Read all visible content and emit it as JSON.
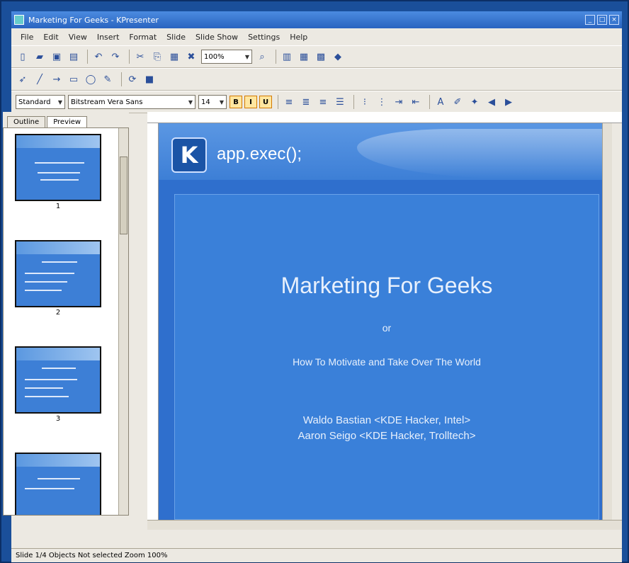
{
  "window": {
    "title": "Marketing For Geeks - KPresenter"
  },
  "menu": [
    "File",
    "Edit",
    "View",
    "Insert",
    "Format",
    "Slide",
    "Slide Show",
    "Settings",
    "Help"
  ],
  "toolbar1": {
    "zoom": "100%"
  },
  "format_toolbar": {
    "style": "Standard",
    "font": "Bitstream Vera Sans",
    "size": "14"
  },
  "sidebar": {
    "tabs": [
      "Outline",
      "Preview"
    ],
    "slides": [
      "1",
      "2",
      "3"
    ]
  },
  "slide": {
    "header": "app.exec();",
    "title": "Marketing For Geeks",
    "or": "or",
    "subtitle": "How To Motivate and Take Over The World",
    "author1": "Waldo Bastian <KDE Hacker, Intel>",
    "author2": "Aaron Seigo <KDE Hacker, Trolltech>"
  },
  "status": "Slide 1/4 Objects Not selected  Zoom 100%"
}
